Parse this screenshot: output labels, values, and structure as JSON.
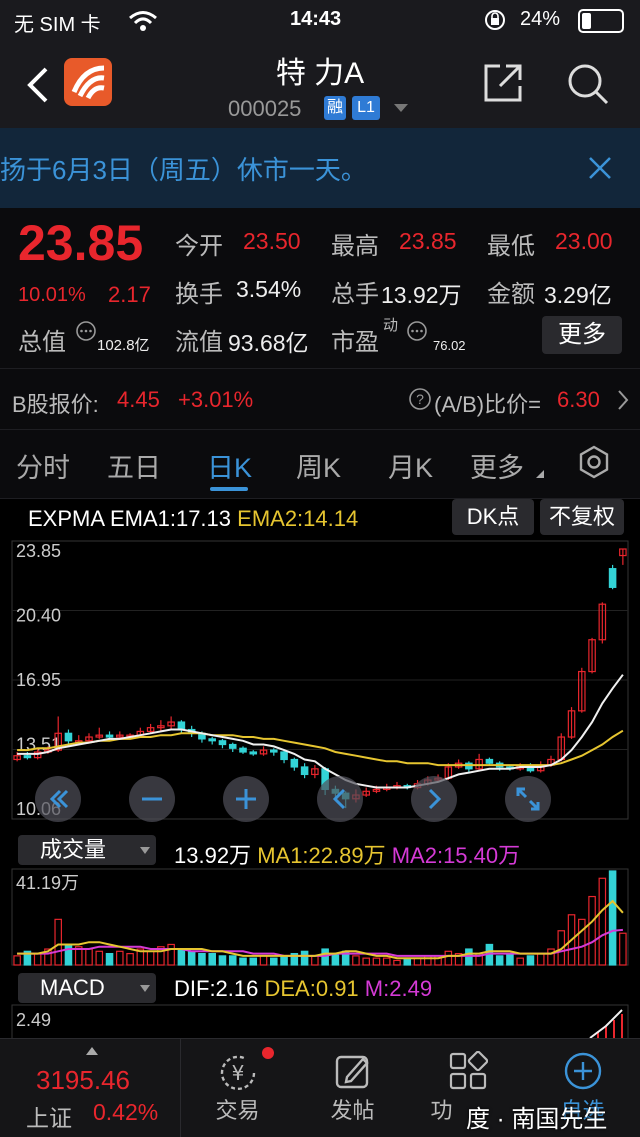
{
  "status_bar": {
    "carrier": "无 SIM 卡",
    "time": "14:43",
    "battery": "24%"
  },
  "header": {
    "title": "特 力A",
    "code": "000025",
    "badge_rong": "融",
    "badge_level": "L1"
  },
  "notice": {
    "text": "扬于6月3日（周五）休市一天。"
  },
  "quote": {
    "price": "23.85",
    "change_pct": "10.01%",
    "change_amt": "2.17",
    "fields": [
      {
        "label": "今开",
        "value": "23.50"
      },
      {
        "label": "最高",
        "value": "23.85"
      },
      {
        "label": "最低",
        "value": "23.00"
      },
      {
        "label": "换手",
        "value": "3.54%"
      },
      {
        "label": "总手",
        "value": "13.92万"
      },
      {
        "label": "金额",
        "value": "3.29亿"
      },
      {
        "label": "总值",
        "value": "102.8亿"
      },
      {
        "label": "流值",
        "value": "93.68亿"
      },
      {
        "label": "市盈",
        "superscript": "动",
        "value": "76.02"
      }
    ],
    "more_label": "更多"
  },
  "b_share": {
    "label": "B股报价:",
    "price": "4.45",
    "change": "+3.01%",
    "ratio_label": "(A/B)比价=",
    "ratio_value": "6.30"
  },
  "tabs": [
    {
      "label": "分时",
      "active": false
    },
    {
      "label": "五日",
      "active": false
    },
    {
      "label": "日K",
      "active": true
    },
    {
      "label": "周K",
      "active": false
    },
    {
      "label": "月K",
      "active": false
    },
    {
      "label": "更多",
      "active": false
    }
  ],
  "kline_legend": {
    "name": "EXPMA",
    "ema1": "EMA1:17.13",
    "ema2": "EMA2:14.14",
    "dk_button": "DK点",
    "fq_button": "不复权"
  },
  "chart_data": [
    {
      "type": "candlestick",
      "y_ticks": [
        "23.85",
        "20.40",
        "16.95",
        "13.51",
        "10.06"
      ],
      "ylim": [
        10.06,
        23.85
      ],
      "candles": [
        [
          12.6,
          12.8,
          13.0,
          12.5
        ],
        [
          12.8,
          12.7,
          13.0,
          12.6
        ],
        [
          12.7,
          13.0,
          13.2,
          12.6
        ],
        [
          13.0,
          13.1,
          13.3,
          12.9
        ],
        [
          13.1,
          14.0,
          14.9,
          13.0
        ],
        [
          14.0,
          13.6,
          14.2,
          13.4
        ],
        [
          13.6,
          13.6,
          13.9,
          13.4
        ],
        [
          13.6,
          13.8,
          14.0,
          13.5
        ],
        [
          13.8,
          13.9,
          14.3,
          13.7
        ],
        [
          13.9,
          13.8,
          14.1,
          13.6
        ],
        [
          13.8,
          13.9,
          14.1,
          13.7
        ],
        [
          13.9,
          13.9,
          14.0,
          13.8
        ],
        [
          13.9,
          14.1,
          14.3,
          13.8
        ],
        [
          14.1,
          14.3,
          14.5,
          14.0
        ],
        [
          14.3,
          14.4,
          14.7,
          14.1
        ],
        [
          14.4,
          14.6,
          14.9,
          14.2
        ],
        [
          14.6,
          14.2,
          14.7,
          14.0
        ],
        [
          14.2,
          14.0,
          14.4,
          13.8
        ],
        [
          14.0,
          13.7,
          14.1,
          13.5
        ],
        [
          13.7,
          13.6,
          13.8,
          13.4
        ],
        [
          13.6,
          13.4,
          13.7,
          13.2
        ],
        [
          13.4,
          13.2,
          13.5,
          13.0
        ],
        [
          13.2,
          13.0,
          13.3,
          12.9
        ],
        [
          13.0,
          12.9,
          13.1,
          12.8
        ],
        [
          12.9,
          13.1,
          13.3,
          12.8
        ],
        [
          13.1,
          13.0,
          13.2,
          12.8
        ],
        [
          13.0,
          12.6,
          13.1,
          12.4
        ],
        [
          12.6,
          12.2,
          12.7,
          12.0
        ],
        [
          12.2,
          11.8,
          12.4,
          11.6
        ],
        [
          11.8,
          12.1,
          12.3,
          11.6
        ],
        [
          12.1,
          11.0,
          12.2,
          10.7
        ],
        [
          11.0,
          10.8,
          11.2,
          10.5
        ],
        [
          10.8,
          10.5,
          10.9,
          10.0
        ],
        [
          10.5,
          10.7,
          11.0,
          10.3
        ],
        [
          10.7,
          10.9,
          11.1,
          10.6
        ],
        [
          10.9,
          11.0,
          11.2,
          10.8
        ],
        [
          11.0,
          11.1,
          11.3,
          10.9
        ],
        [
          11.1,
          11.2,
          11.4,
          11.0
        ],
        [
          11.2,
          11.1,
          11.3,
          11.0
        ],
        [
          11.1,
          11.3,
          11.5,
          11.0
        ],
        [
          11.3,
          11.5,
          11.7,
          11.2
        ],
        [
          11.5,
          11.6,
          11.8,
          11.4
        ],
        [
          11.6,
          12.2,
          12.4,
          11.5
        ],
        [
          12.2,
          12.4,
          12.6,
          12.1
        ],
        [
          12.4,
          12.1,
          12.5,
          11.9
        ],
        [
          12.1,
          12.6,
          12.9,
          12.0
        ],
        [
          12.6,
          12.4,
          12.7,
          12.3
        ],
        [
          12.4,
          12.2,
          12.5,
          12.0
        ],
        [
          12.2,
          12.1,
          12.3,
          12.0
        ],
        [
          12.1,
          12.3,
          12.4,
          12.0
        ],
        [
          12.3,
          12.0,
          12.4,
          11.9
        ],
        [
          12.0,
          12.3,
          12.5,
          11.9
        ],
        [
          12.3,
          12.6,
          12.8,
          12.2
        ],
        [
          12.6,
          13.8,
          14.0,
          12.5
        ],
        [
          13.8,
          15.2,
          15.4,
          13.7
        ],
        [
          15.2,
          17.3,
          17.5,
          15.1
        ],
        [
          17.3,
          19.0,
          19.1,
          17.2
        ],
        [
          19.0,
          20.9,
          21.0,
          18.8
        ],
        [
          22.8,
          21.8,
          23.0,
          21.7
        ],
        [
          23.5,
          23.85,
          23.85,
          23.0
        ]
      ],
      "ema1": [
        12.9,
        12.9,
        12.9,
        13.0,
        13.2,
        13.3,
        13.4,
        13.5,
        13.6,
        13.7,
        13.7,
        13.8,
        13.9,
        14.0,
        14.1,
        14.2,
        14.2,
        14.1,
        14.0,
        13.9,
        13.8,
        13.7,
        13.6,
        13.4,
        13.4,
        13.3,
        13.1,
        12.9,
        12.6,
        12.5,
        12.1,
        11.8,
        11.5,
        11.3,
        11.2,
        11.1,
        11.1,
        11.1,
        11.1,
        11.2,
        11.3,
        11.4,
        11.6,
        11.8,
        11.9,
        12.0,
        12.1,
        12.1,
        12.1,
        12.2,
        12.2,
        12.2,
        12.3,
        12.6,
        13.1,
        13.8,
        14.6,
        15.6,
        16.4,
        17.13
      ],
      "ema2": [
        13.1,
        13.1,
        13.2,
        13.2,
        13.3,
        13.4,
        13.5,
        13.5,
        13.6,
        13.6,
        13.7,
        13.7,
        13.8,
        13.8,
        13.9,
        13.9,
        14.0,
        14.0,
        14.0,
        13.9,
        13.9,
        13.9,
        13.8,
        13.8,
        13.7,
        13.7,
        13.6,
        13.5,
        13.4,
        13.3,
        13.2,
        13.0,
        12.9,
        12.8,
        12.7,
        12.6,
        12.5,
        12.5,
        12.4,
        12.4,
        12.4,
        12.3,
        12.3,
        12.3,
        12.3,
        12.3,
        12.3,
        12.3,
        12.3,
        12.3,
        12.3,
        12.3,
        12.3,
        12.4,
        12.6,
        12.8,
        13.1,
        13.4,
        13.8,
        14.14
      ]
    },
    {
      "type": "bar",
      "name": "成交量",
      "value_label": "13.92万",
      "ma1_label": "MA1:22.89万",
      "ma2_label": "MA2:15.40万",
      "y_tick": "41.19万",
      "ylim": [
        0,
        41.19
      ],
      "values": [
        4,
        6,
        5,
        7,
        20,
        9,
        8,
        7,
        6,
        5,
        6,
        5,
        7,
        6,
        8,
        9,
        7,
        6,
        5,
        5,
        4,
        4,
        3,
        3,
        4,
        3,
        4,
        5,
        6,
        4,
        7,
        5,
        6,
        4,
        3,
        3,
        3,
        2,
        3,
        3,
        4,
        4,
        6,
        5,
        7,
        5,
        9,
        4,
        5,
        3,
        4,
        5,
        7,
        15,
        22,
        20,
        30,
        38,
        41.19,
        13.92
      ],
      "ma1": [
        5,
        5,
        5,
        6,
        9,
        9,
        9,
        10,
        10,
        9,
        8,
        7,
        6,
        6,
        6,
        7,
        7,
        7,
        7,
        6,
        6,
        5,
        4,
        4,
        4,
        4,
        4,
        4,
        4,
        4,
        5,
        5,
        6,
        6,
        5,
        4,
        4,
        3,
        3,
        3,
        3,
        3,
        4,
        4,
        5,
        5,
        6,
        6,
        6,
        5,
        5,
        5,
        5,
        7,
        11,
        15,
        19,
        24,
        28,
        22.89
      ],
      "ma2": [
        5,
        5,
        5,
        5,
        6,
        7,
        7,
        7,
        8,
        8,
        8,
        8,
        8,
        7,
        7,
        7,
        7,
        6,
        6,
        6,
        6,
        6,
        6,
        5,
        5,
        5,
        4,
        4,
        4,
        4,
        4,
        5,
        5,
        5,
        5,
        5,
        5,
        4,
        4,
        4,
        4,
        4,
        4,
        4,
        4,
        4,
        5,
        5,
        5,
        5,
        5,
        5,
        5,
        6,
        7,
        8,
        10,
        13,
        15,
        15.4
      ]
    },
    {
      "type": "line",
      "name": "MACD",
      "dif_label": "DIF:2.16",
      "dea_label": "DEA:0.91",
      "m_label": "M:2.49",
      "y_tick": "2.49"
    }
  ],
  "volume_selector": {
    "label": "成交量"
  },
  "macd_selector": {
    "label": "MACD"
  },
  "bottom_nav": {
    "index_value": "3195.46",
    "index_name": "上证",
    "index_change": "0.42%",
    "items": [
      "交易",
      "发帖",
      "功",
      "自选"
    ],
    "watermark": "度 · 南国先生"
  },
  "colors": {
    "up": "#e8262d",
    "down": "#33d3d6",
    "ema1": "#f0f0f0",
    "ema2": "#e6c530",
    "ma2": "#d53ad6",
    "accent": "#3b93d8"
  }
}
